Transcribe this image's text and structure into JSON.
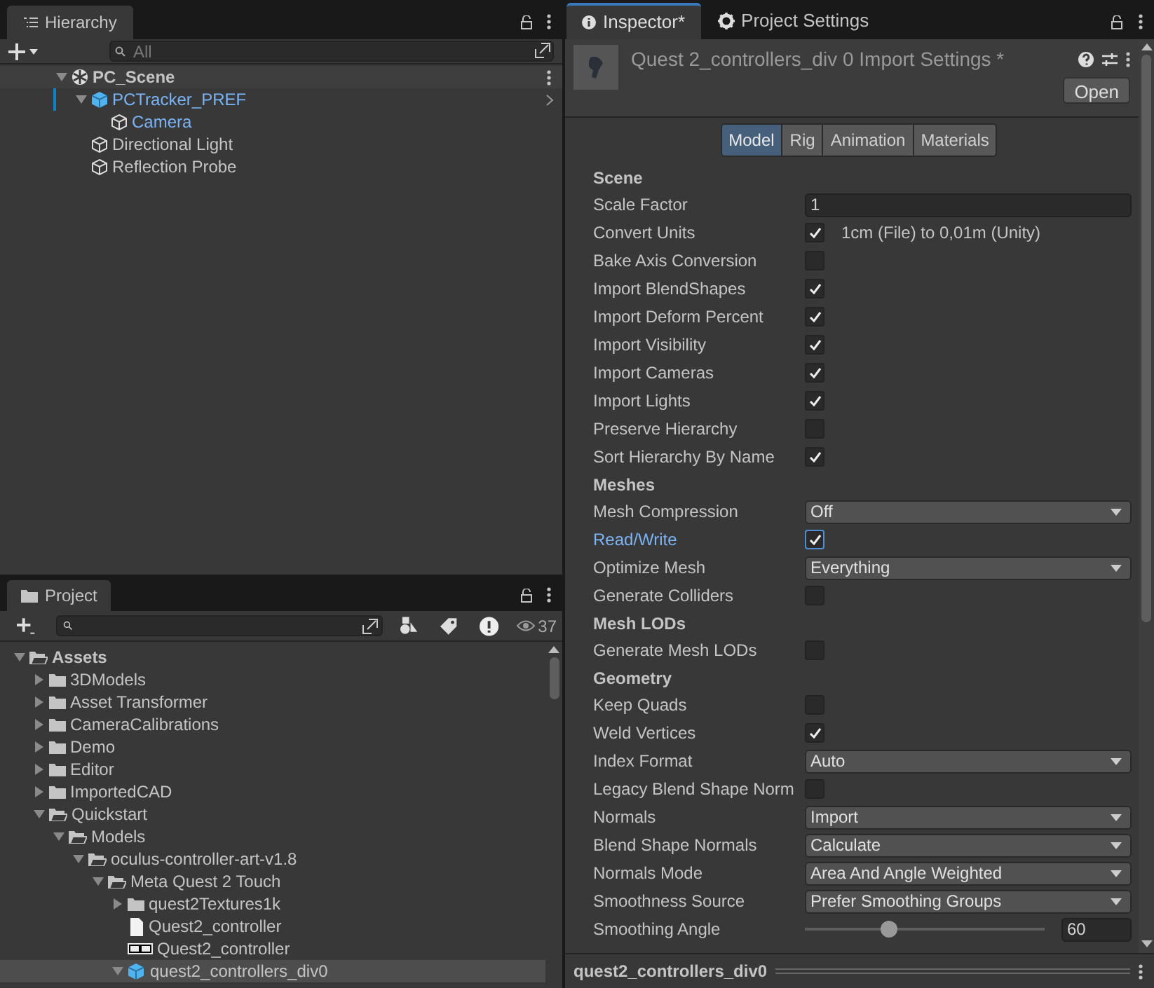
{
  "hierarchy": {
    "tab": "Hierarchy",
    "search": {
      "placeholder": "All"
    },
    "items": [
      {
        "label": "PC_Scene",
        "kind": "scene",
        "expanded": true,
        "in_prefab": false,
        "modified": false,
        "children": [
          {
            "label": "PCTracker_PREF",
            "kind": "prefab",
            "expanded": true,
            "in_prefab": true,
            "modified": true,
            "children": [
              {
                "label": "Camera",
                "kind": "gameobject",
                "in_prefab": true,
                "modified": false
              }
            ]
          },
          {
            "label": "Directional Light",
            "kind": "gameobject",
            "in_prefab": false,
            "modified": false
          },
          {
            "label": "Reflection Probe",
            "kind": "gameobject",
            "in_prefab": false,
            "modified": false
          }
        ]
      }
    ]
  },
  "project": {
    "tab": "Project",
    "hidden_count": "37",
    "items": [
      {
        "label": "Assets",
        "kind": "folder",
        "expanded": true,
        "selected": false,
        "children": [
          {
            "label": "3DModels",
            "kind": "folder",
            "expanded": false,
            "selected": false
          },
          {
            "label": "Asset Transformer",
            "kind": "folder",
            "expanded": false,
            "selected": false
          },
          {
            "label": "CameraCalibrations",
            "kind": "folder",
            "expanded": false,
            "selected": false
          },
          {
            "label": "Demo",
            "kind": "folder",
            "expanded": false,
            "selected": false
          },
          {
            "label": "Editor",
            "kind": "folder",
            "expanded": false,
            "selected": false
          },
          {
            "label": "ImportedCAD",
            "kind": "folder",
            "expanded": false,
            "selected": false
          },
          {
            "label": "Quickstart",
            "kind": "folder",
            "expanded": true,
            "selected": false,
            "children": [
              {
                "label": "Models",
                "kind": "folder",
                "expanded": true,
                "selected": false,
                "children": [
                  {
                    "label": "oculus-controller-art-v1.8",
                    "kind": "folder",
                    "expanded": true,
                    "selected": false,
                    "children": [
                      {
                        "label": "Meta Quest 2 Touch",
                        "kind": "folder",
                        "expanded": true,
                        "selected": false,
                        "children": [
                          {
                            "label": "quest2Textures1k",
                            "kind": "folder",
                            "expanded": false,
                            "selected": false
                          },
                          {
                            "label": "Quest2_controller",
                            "kind": "file",
                            "selected": false
                          },
                          {
                            "label": "Quest2_controller",
                            "kind": "texture",
                            "selected": false
                          },
                          {
                            "label": "quest2_controllers_div0",
                            "kind": "model",
                            "expanded": true,
                            "selected": true
                          }
                        ]
                      }
                    ]
                  }
                ]
              }
            ]
          }
        ]
      }
    ]
  },
  "inspector": {
    "tabs": [
      {
        "label": "Inspector*",
        "kind": "info",
        "selected": true
      },
      {
        "label": "Project Settings",
        "kind": "gear",
        "selected": false
      }
    ],
    "title": "Quest 2_controllers_div 0 Import Settings *",
    "open_button": "Open",
    "subtabs": [
      {
        "label": "Model",
        "selected": true
      },
      {
        "label": "Rig",
        "selected": false
      },
      {
        "label": "Animation",
        "selected": false
      },
      {
        "label": "Materials",
        "selected": false
      }
    ],
    "rows": [
      {
        "kind": "header",
        "label": "Scene"
      },
      {
        "kind": "text",
        "label": "Scale Factor",
        "value": "1"
      },
      {
        "kind": "checkbox",
        "label": "Convert Units",
        "checked": true,
        "note": "1cm (File) to 0,01m (Unity)"
      },
      {
        "kind": "checkbox",
        "label": "Bake Axis Conversion",
        "checked": false
      },
      {
        "kind": "checkbox",
        "label": "Import BlendShapes",
        "checked": true
      },
      {
        "kind": "checkbox",
        "label": "Import Deform Percent",
        "checked": true
      },
      {
        "kind": "checkbox",
        "label": "Import Visibility",
        "checked": true
      },
      {
        "kind": "checkbox",
        "label": "Import Cameras",
        "checked": true
      },
      {
        "kind": "checkbox",
        "label": "Import Lights",
        "checked": true
      },
      {
        "kind": "checkbox",
        "label": "Preserve Hierarchy",
        "checked": false
      },
      {
        "kind": "checkbox",
        "label": "Sort Hierarchy By Name",
        "checked": true
      },
      {
        "kind": "header",
        "label": "Meshes"
      },
      {
        "kind": "dropdown",
        "label": "Mesh Compression",
        "value": "Off"
      },
      {
        "kind": "checkbox",
        "label": "Read/Write",
        "checked": true,
        "modified": true
      },
      {
        "kind": "dropdown",
        "label": "Optimize Mesh",
        "value": "Everything"
      },
      {
        "kind": "checkbox",
        "label": "Generate Colliders",
        "checked": false
      },
      {
        "kind": "header",
        "label": "Mesh LODs"
      },
      {
        "kind": "checkbox",
        "label": "Generate Mesh LODs",
        "checked": false
      },
      {
        "kind": "header",
        "label": "Geometry"
      },
      {
        "kind": "checkbox",
        "label": "Keep Quads",
        "checked": false
      },
      {
        "kind": "checkbox",
        "label": "Weld Vertices",
        "checked": true
      },
      {
        "kind": "dropdown",
        "label": "Index Format",
        "value": "Auto"
      },
      {
        "kind": "checkbox",
        "label": "Legacy Blend Shape Norm",
        "checked": false
      },
      {
        "kind": "dropdown",
        "label": "Normals",
        "value": "Import"
      },
      {
        "kind": "dropdown",
        "label": "Blend Shape Normals",
        "value": "Calculate"
      },
      {
        "kind": "dropdown",
        "label": "Normals Mode",
        "value": "Area And Angle Weighted"
      },
      {
        "kind": "dropdown",
        "label": "Smoothness Source",
        "value": "Prefer Smoothing Groups"
      },
      {
        "kind": "slider",
        "label": "Smoothing Angle",
        "level": 0.34,
        "value": "60"
      }
    ],
    "footer": "quest2_controllers_div0"
  }
}
